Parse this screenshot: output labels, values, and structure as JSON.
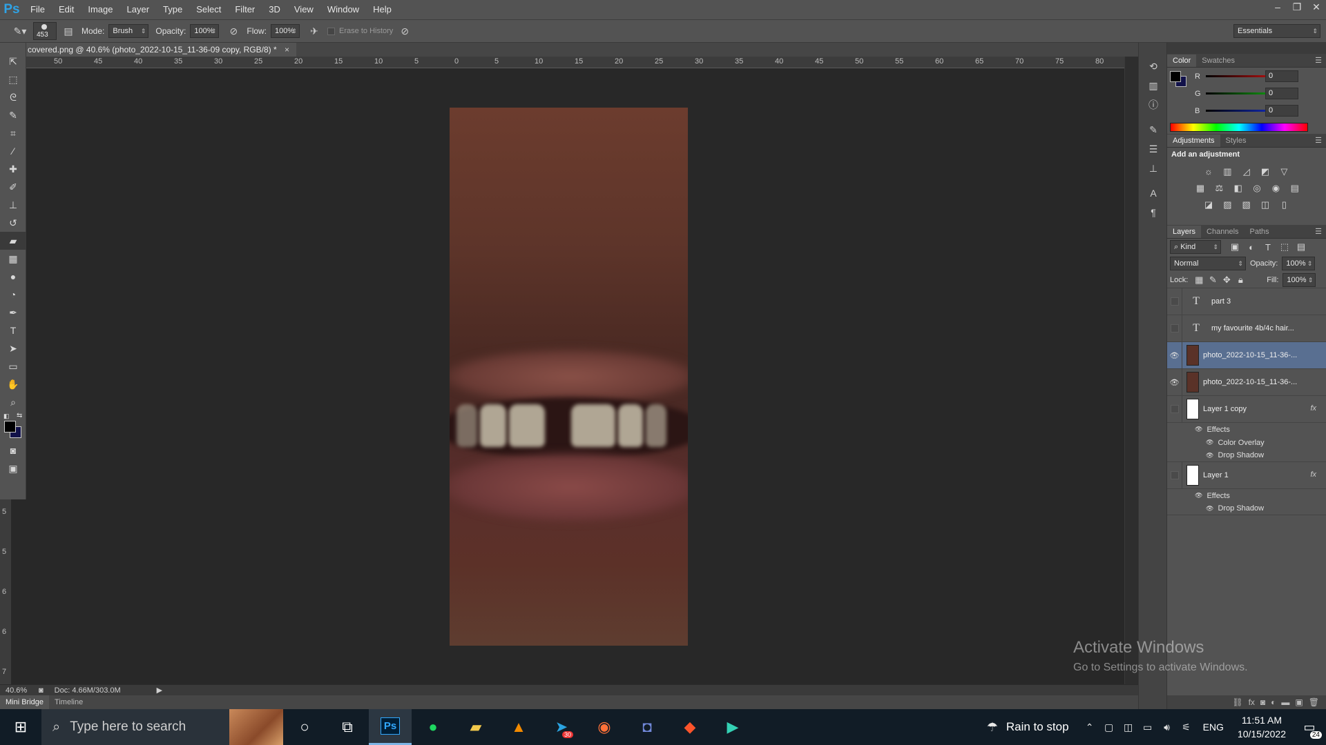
{
  "menubar": {
    "logo": "Ps",
    "items": [
      "File",
      "Edit",
      "Image",
      "Layer",
      "Type",
      "Select",
      "Filter",
      "3D",
      "View",
      "Window",
      "Help"
    ]
  },
  "options": {
    "brush_size": "453",
    "mode_label": "Mode:",
    "mode_value": "Brush",
    "opacity_label": "Opacity:",
    "opacity_value": "100%",
    "flow_label": "Flow:",
    "flow_value": "100%",
    "erase_history_label": "Erase to History",
    "workspace": "Essentials"
  },
  "document": {
    "tab_title": "covered.png @ 40.6% (photo_2022-10-15_11-36-09 copy, RGB/8) *",
    "ruler_h": [
      "50",
      "45",
      "40",
      "35",
      "30",
      "25",
      "20",
      "15",
      "10",
      "5",
      "0",
      "5",
      "10",
      "15",
      "20",
      "25",
      "30",
      "35",
      "40",
      "45",
      "50",
      "55",
      "60",
      "65",
      "70",
      "75",
      "80"
    ],
    "ruler_v": [
      "5",
      "5",
      "6",
      "6",
      "7"
    ]
  },
  "status": {
    "zoom": "40.6%",
    "doc": "Doc: 4.66M/303.0M"
  },
  "bottom_tabs": [
    "Mini Bridge",
    "Timeline"
  ],
  "color_panel": {
    "tabs": [
      "Color",
      "Swatches"
    ],
    "channels": [
      {
        "label": "R",
        "value": "0",
        "color": "#d41414"
      },
      {
        "label": "G",
        "value": "0",
        "color": "#14b414"
      },
      {
        "label": "B",
        "value": "0",
        "color": "#1430d4"
      }
    ]
  },
  "adjustments_panel": {
    "tabs": [
      "Adjustments",
      "Styles"
    ],
    "heading": "Add an adjustment"
  },
  "layers_panel": {
    "tabs": [
      "Layers",
      "Channels",
      "Paths"
    ],
    "kind_filter": "Kind",
    "blend_mode": "Normal",
    "opacity_label": "Opacity:",
    "opacity_value": "100%",
    "lock_label": "Lock:",
    "fill_label": "Fill:",
    "fill_value": "100%",
    "layers": [
      {
        "name": "part 3",
        "type": "text",
        "visible": false
      },
      {
        "name": "my favourite 4b/4c hair...",
        "type": "text",
        "visible": false
      },
      {
        "name": "photo_2022-10-15_11-36-...",
        "type": "image",
        "visible": true,
        "selected": true
      },
      {
        "name": "photo_2022-10-15_11-36-...",
        "type": "image",
        "visible": true
      },
      {
        "name": "Layer 1 copy",
        "type": "image",
        "visible": false,
        "fx": "fx",
        "effects_label": "Effects",
        "effects": [
          "Color Overlay",
          "Drop Shadow"
        ]
      },
      {
        "name": "Layer 1",
        "type": "image",
        "visible": false,
        "fx": "fx",
        "effects_label": "Effects",
        "effects": [
          "Drop Shadow"
        ]
      }
    ]
  },
  "watermark": {
    "line1": "Activate Windows",
    "line2": "Go to Settings to activate Windows."
  },
  "taskbar": {
    "search_placeholder": "Type here to search",
    "telegram_badge": "30",
    "weather": "Rain to stop",
    "lang": "ENG",
    "time": "11:51 AM",
    "date": "10/15/2022",
    "notif_count": "24"
  }
}
